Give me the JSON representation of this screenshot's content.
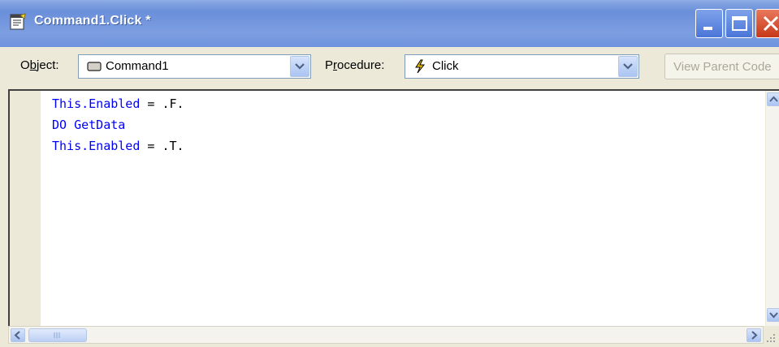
{
  "window": {
    "title": "Command1.Click *"
  },
  "toolbar": {
    "object_label_prefix": "O",
    "object_label_underline": "b",
    "object_label_rest": "ject:",
    "object_value": "Command1",
    "procedure_label_prefix": "P",
    "procedure_label_underline": "r",
    "procedure_label_rest": "ocedure:",
    "procedure_value": "Click",
    "view_parent_code_label": "View Parent Code"
  },
  "code": {
    "lines": [
      {
        "kw": "This.Enabled",
        "rest": " = .F."
      },
      {
        "kw": "DO GetData",
        "rest": ""
      },
      {
        "kw": "This.Enabled",
        "rest": " = .T."
      }
    ]
  },
  "icons": {
    "title_icon": "code-window-icon",
    "object_icon": "command-button-icon",
    "procedure_icon": "lightning-event-icon",
    "minimize": "minimize-icon",
    "maximize": "maximize-icon",
    "close": "close-icon"
  },
  "colors": {
    "titlebar": "#7fa0df",
    "close_button": "#c6391a",
    "keyword": "#0000ff",
    "event_icon": "#e8c000"
  }
}
